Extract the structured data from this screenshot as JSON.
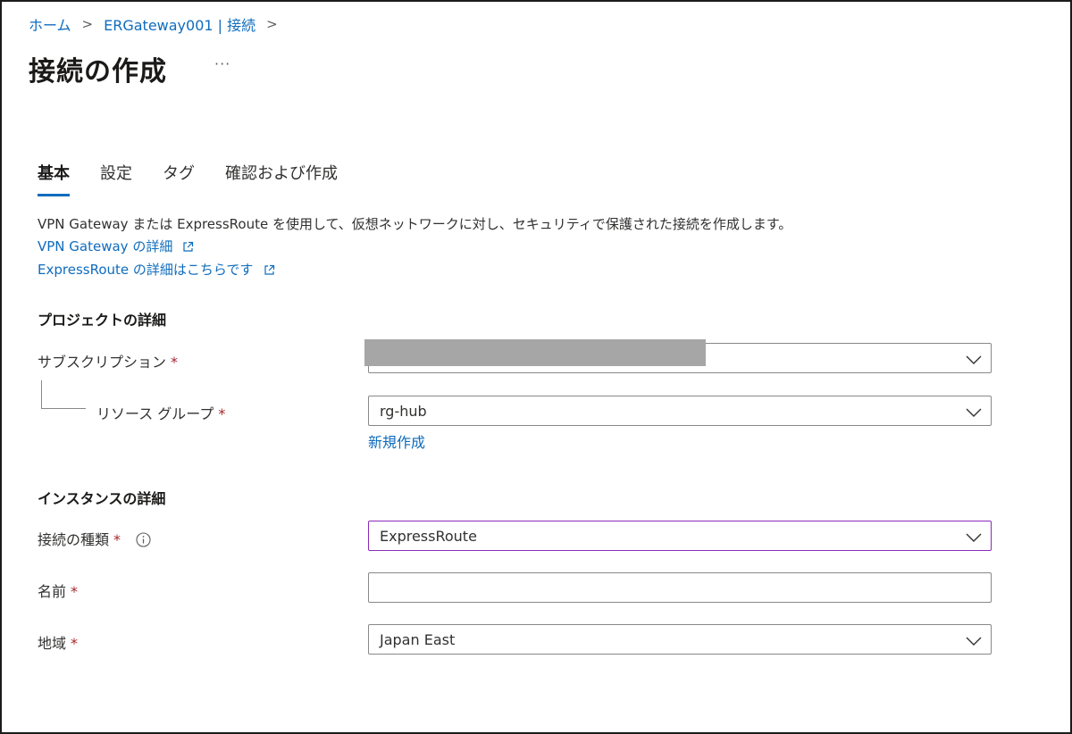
{
  "breadcrumb": {
    "items": [
      "ホーム",
      "ERGateway001 | 接続"
    ]
  },
  "page": {
    "title": "接続の作成",
    "more_label": "···"
  },
  "tabs": [
    {
      "label": "基本",
      "active": true
    },
    {
      "label": "設定",
      "active": false
    },
    {
      "label": "タグ",
      "active": false
    },
    {
      "label": "確認および作成",
      "active": false
    }
  ],
  "intro": {
    "description": "VPN Gateway または ExpressRoute を使用して、仮想ネットワークに対し、セキュリティで保護された接続を作成します。",
    "link_vpn": "VPN Gateway の詳細",
    "link_er": "ExpressRoute の詳細はこちらです"
  },
  "project": {
    "heading": "プロジェクトの詳細",
    "subscription_label": "サブスクリプション",
    "subscription_value": "",
    "resource_group_label": "リソース グループ",
    "resource_group_value": "rg-hub",
    "create_new_link": "新規作成"
  },
  "instance": {
    "heading": "インスタンスの詳細",
    "connection_type_label": "接続の種類",
    "connection_type_value": "ExpressRoute",
    "name_label": "名前",
    "name_value": "",
    "region_label": "地域",
    "region_value": "Japan East"
  },
  "required_marker": "*",
  "colors": {
    "link": "#0f6cbd",
    "required": "#a4262c",
    "focus_border": "#8a2bb8"
  }
}
